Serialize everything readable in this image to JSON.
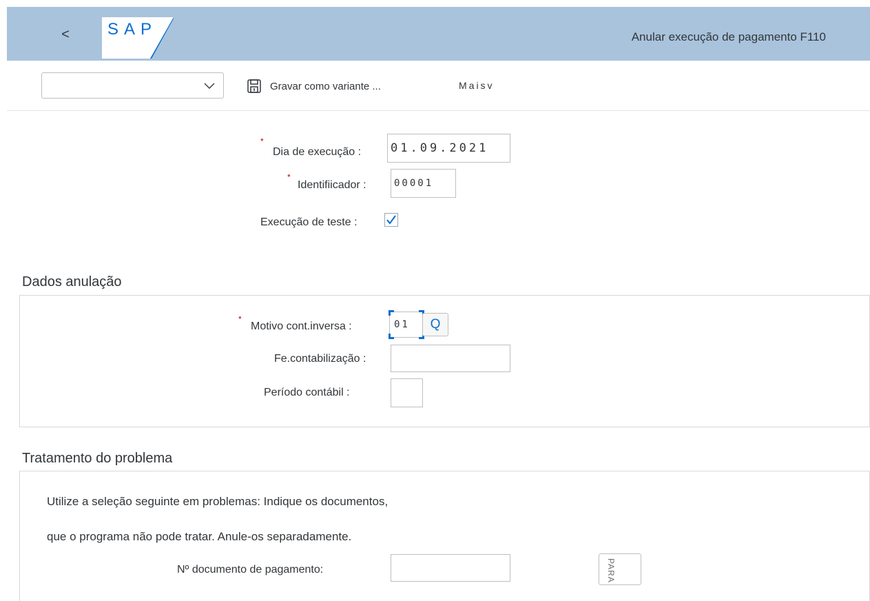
{
  "header": {
    "back_label": "<",
    "logo_text": "SAP",
    "app_title": "Anular execução de pagamento F110"
  },
  "toolbar": {
    "variant_value": "",
    "save_variant_label": "Gravar como variante ...",
    "more_label": "Maisv"
  },
  "fields": {
    "run_date": {
      "label": "Dia de execução :",
      "value": "01.09.2021",
      "required_mark": "*"
    },
    "identifier": {
      "label": "Identifiicador :",
      "value": "00001",
      "required_mark": "*"
    },
    "test_run": {
      "label": "Execução de teste :",
      "checked": true
    }
  },
  "reversal": {
    "title": "Dados anulação",
    "reason": {
      "label": "Motivo cont.inversa :",
      "value": "01",
      "required_mark": "*",
      "search_label": "Q"
    },
    "posting_date": {
      "label": "Fe.contabilização :",
      "value": ""
    },
    "period": {
      "label": "Período contábil :",
      "value": ""
    }
  },
  "problem": {
    "title": "Tratamento do problema",
    "line1": "Utilize a seleção seguinte em problemas: Indique os documentos,",
    "line2": "que o programa não pode tratar. Anule-os separadamente.",
    "doc": {
      "label": "Nº documento de pagamento:",
      "value": ""
    },
    "para_label": "PARA"
  },
  "colors": {
    "header_bg": "#a9c3dc",
    "accent": "#0a6ed1",
    "required": "#bb0000"
  }
}
